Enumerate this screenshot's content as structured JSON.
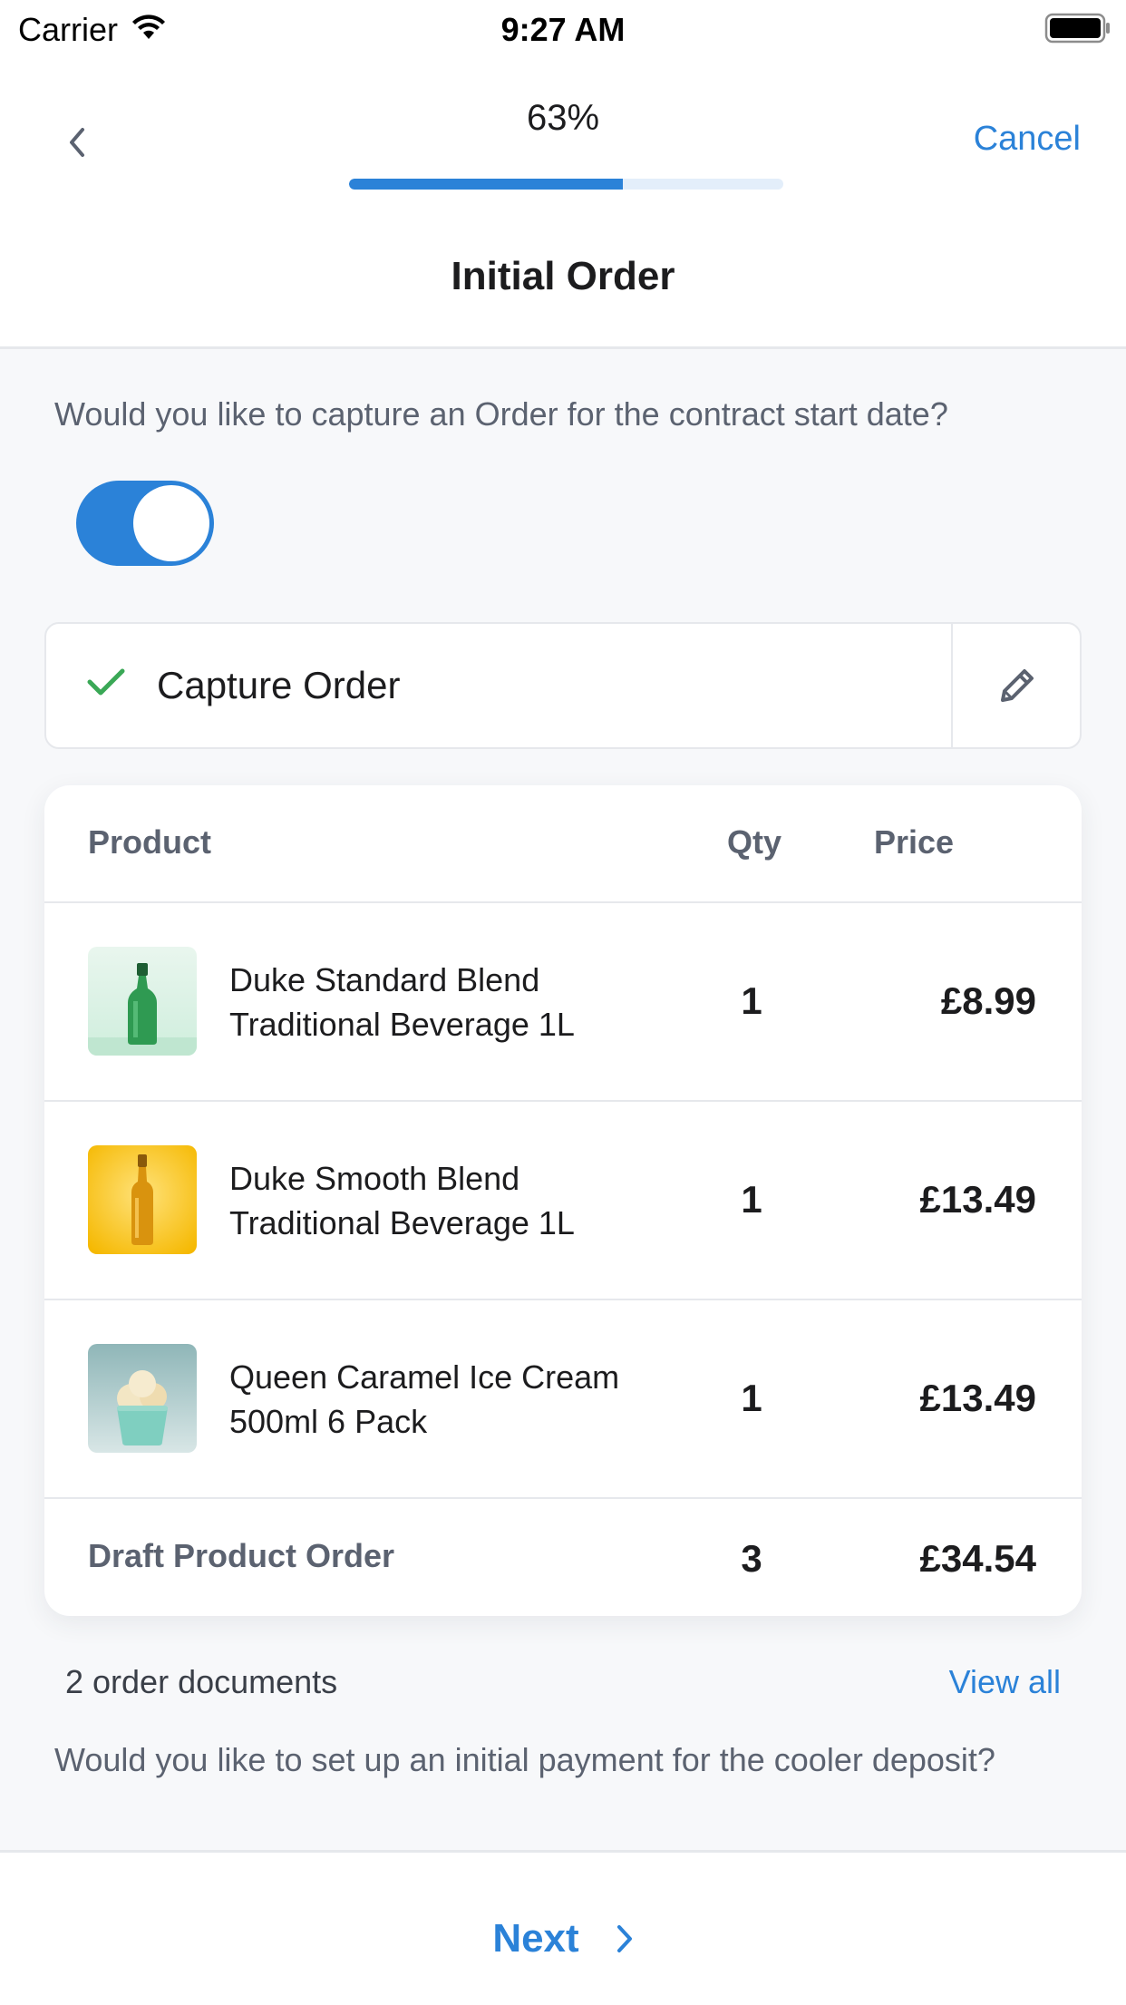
{
  "status_bar": {
    "carrier": "Carrier",
    "time": "9:27 AM"
  },
  "header": {
    "progress_label": "63%",
    "progress_value": 0.63,
    "cancel_label": "Cancel",
    "title": "Initial Order"
  },
  "order_question": "Would you like to capture an Order for the contract start date?",
  "order_toggle_on": true,
  "capture": {
    "label": "Capture Order",
    "status_icon": "check-icon",
    "edit_icon": "pencil-icon"
  },
  "order_table": {
    "headers": {
      "product": "Product",
      "qty": "Qty",
      "price": "Price"
    },
    "items": [
      {
        "name_line1": "Duke Standard Blend",
        "name_line2": "Traditional Beverage 1L",
        "qty": "1",
        "price": "£8.99",
        "image": "green-bottle"
      },
      {
        "name_line1": "Duke Smooth Blend",
        "name_line2": "Traditional Beverage 1L",
        "qty": "1",
        "price": "£13.49",
        "image": "amber-bottle"
      },
      {
        "name_line1": "Queen Caramel Ice Cream",
        "name_line2": "500ml 6 Pack",
        "qty": "1",
        "price": "£13.49",
        "image": "ice-cream-cup"
      }
    ],
    "total": {
      "label": "Draft Product Order",
      "qty": "3",
      "price": "£34.54"
    }
  },
  "documents": {
    "count_label": "2 order documents",
    "view_all_label": "View all"
  },
  "payment_question": "Would you like to set up an initial payment for the cooler deposit?",
  "footer": {
    "next_label": "Next"
  },
  "colors": {
    "accent": "#2b82d8",
    "success": "#3aa856",
    "muted_text": "#5b6270"
  }
}
